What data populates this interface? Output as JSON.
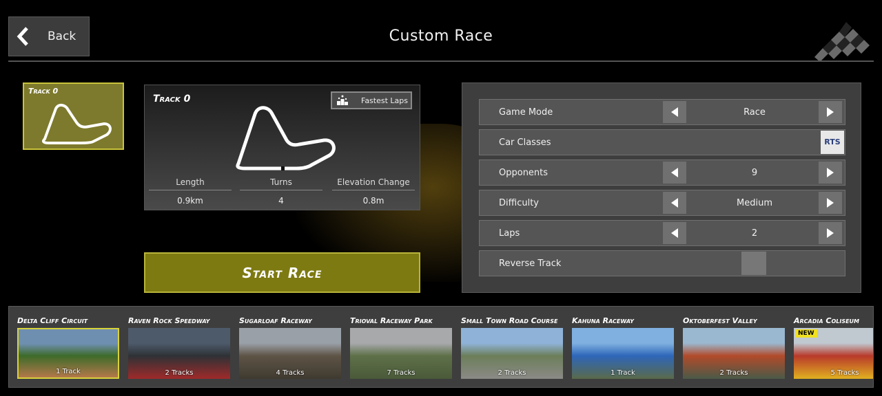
{
  "header": {
    "back_label": "Back",
    "title": "Custom Race"
  },
  "selected_track": {
    "name": "Track 0"
  },
  "track_info": {
    "name": "Track 0",
    "fastest_laps_label": "Fastest Laps",
    "stats": [
      {
        "label": "Length",
        "value": "0.9km"
      },
      {
        "label": "Turns",
        "value": "4"
      },
      {
        "label": "Elevation Change",
        "value": "0.8m"
      }
    ]
  },
  "start_button": "Start Race",
  "settings": {
    "game_mode": {
      "label": "Game Mode",
      "value": "Race"
    },
    "car_classes": {
      "label": "Car Classes",
      "badge": "RTS"
    },
    "opponents": {
      "label": "Opponents",
      "value": "9"
    },
    "difficulty": {
      "label": "Difficulty",
      "value": "Medium"
    },
    "laps": {
      "label": "Laps",
      "value": "2"
    },
    "reverse_track": {
      "label": "Reverse Track",
      "enabled": false
    }
  },
  "venues": [
    {
      "name": "Delta Cliff Circuit",
      "count": "1 Track",
      "selected": true,
      "colors": [
        "#6f8fb0",
        "#3d6b2a",
        "#b4784a"
      ]
    },
    {
      "name": "Raven Rock Speedway",
      "count": "2 Tracks",
      "colors": [
        "#4d5a6a",
        "#2e3236",
        "#a02a2a"
      ]
    },
    {
      "name": "Sugarloaf Raceway",
      "count": "4 Tracks",
      "colors": [
        "#9aa0a8",
        "#5e5446",
        "#3f3a30"
      ]
    },
    {
      "name": "Trioval Raceway Park",
      "count": "7 Tracks",
      "colors": [
        "#a7a9ab",
        "#5e7048",
        "#4a5a3a"
      ]
    },
    {
      "name": "Small Town Road Course",
      "count": "2 Tracks",
      "colors": [
        "#8fb3d8",
        "#6c7e5a",
        "#8a8a86"
      ]
    },
    {
      "name": "Kahuna Raceway",
      "count": "1 Track",
      "colors": [
        "#7fb0e0",
        "#2e66b8",
        "#5a6a4a"
      ]
    },
    {
      "name": "Oktoberfest Valley",
      "count": "2 Tracks",
      "colors": [
        "#9ab8d0",
        "#b24a2a",
        "#4a5a48"
      ]
    },
    {
      "name": "Arcadia Coliseum",
      "count": "5 Tracks",
      "badge": "NEW",
      "colors": [
        "#c0c8d0",
        "#b83a2a",
        "#e0b020"
      ]
    }
  ]
}
